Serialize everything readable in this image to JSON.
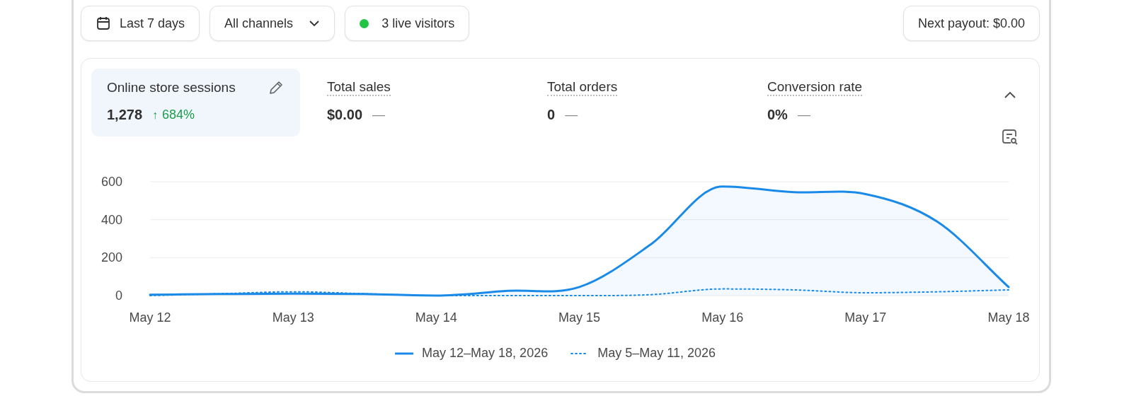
{
  "toolbar": {
    "date_range": {
      "label": "Last 7 days"
    },
    "channel_select": {
      "label": "All channels"
    },
    "live_visitors": {
      "label": "3 live visitors",
      "color": "#22c543"
    },
    "payout": {
      "label": "Next payout: $0.00"
    }
  },
  "metrics": [
    {
      "label": "Online store sessions",
      "value": "1,278",
      "arrow": "↑",
      "change": "684%",
      "positive": true,
      "selected": true,
      "editable": true
    },
    {
      "label": "Total sales",
      "value": "$0.00",
      "change": "—",
      "positive": false,
      "selected": false,
      "editable": false
    },
    {
      "label": "Total orders",
      "value": "0",
      "change": "—",
      "positive": false,
      "selected": false,
      "editable": false
    },
    {
      "label": "Conversion rate",
      "value": "0%",
      "change": "—",
      "positive": false,
      "selected": false,
      "editable": false
    }
  ],
  "expanded": true,
  "chart_data": {
    "type": "area",
    "legend": "bottom",
    "categories": [
      "May 12",
      null,
      "May 13",
      null,
      "May 14",
      null,
      "May 15",
      null,
      "May 16",
      null,
      "May 17",
      null,
      "May 18"
    ],
    "yticks": [
      0,
      200,
      400,
      600
    ],
    "ylim": [
      0,
      600
    ],
    "series": [
      {
        "name": "May 12–May 18, 2026",
        "type": "area",
        "color": "#1a8ae8",
        "line_style": "solid",
        "values": [
          5,
          8,
          10,
          8,
          0,
          25,
          45,
          270,
          575,
          545,
          535,
          390,
          45
        ]
      },
      {
        "name": "May 5–May 11, 2026",
        "type": "line",
        "color": "#1a8ae8",
        "line_style": "dotted",
        "values": [
          0,
          10,
          20,
          10,
          0,
          0,
          0,
          5,
          35,
          30,
          15,
          20,
          30
        ]
      }
    ]
  }
}
